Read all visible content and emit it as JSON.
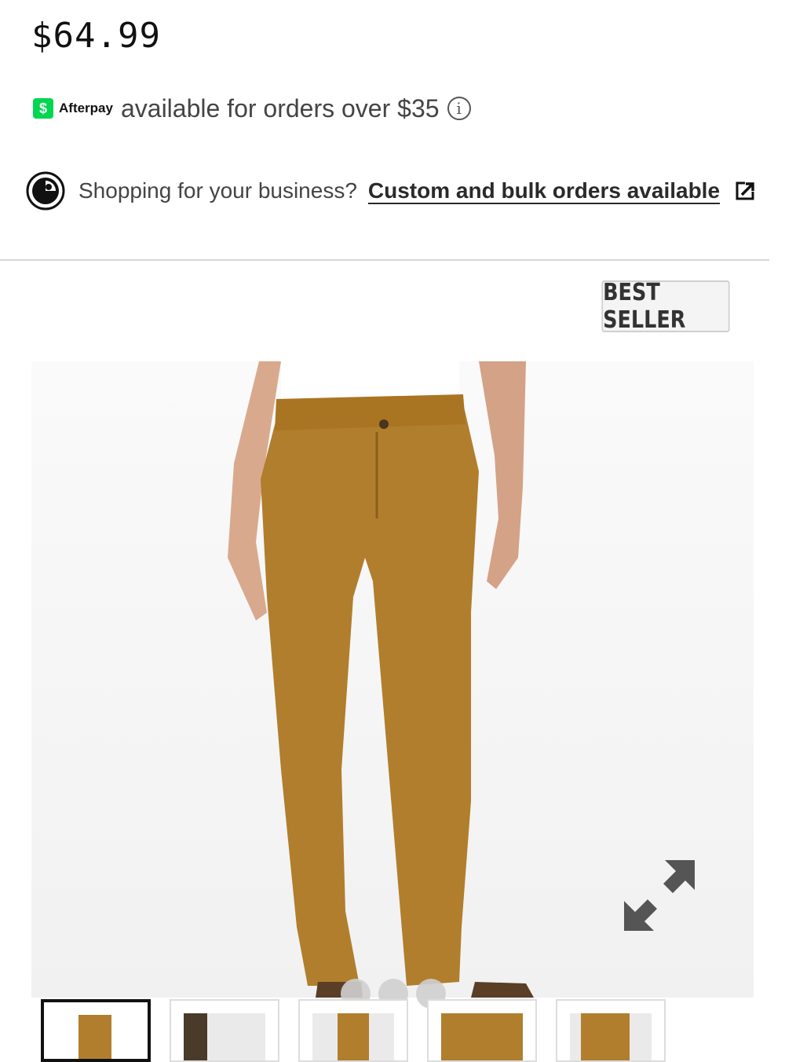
{
  "product": {
    "price": "$64.99",
    "badge": "BEST SELLER"
  },
  "afterpay": {
    "badge_symbol": "$",
    "brand": "Afterpay",
    "text": "available for orders over $35",
    "info_symbol": "i"
  },
  "business": {
    "prompt": "Shopping for your business?",
    "link": "Custom and bulk orders available"
  },
  "gallery": {
    "slide_count": 3,
    "active_slide": 1,
    "thumbnails": [
      "thumbnail-1",
      "thumbnail-2",
      "thumbnail-3",
      "thumbnail-4",
      "thumbnail-5"
    ],
    "active_thumbnail": 1
  },
  "icons": {
    "business": "circle-logo-icon",
    "external": "external-link-icon",
    "expand": "expand-arrows-icon",
    "info": "info-icon"
  },
  "colors": {
    "afterpay_green": "#00d64f",
    "pants": "#b07e2d",
    "divider": "#d6d6d6"
  }
}
